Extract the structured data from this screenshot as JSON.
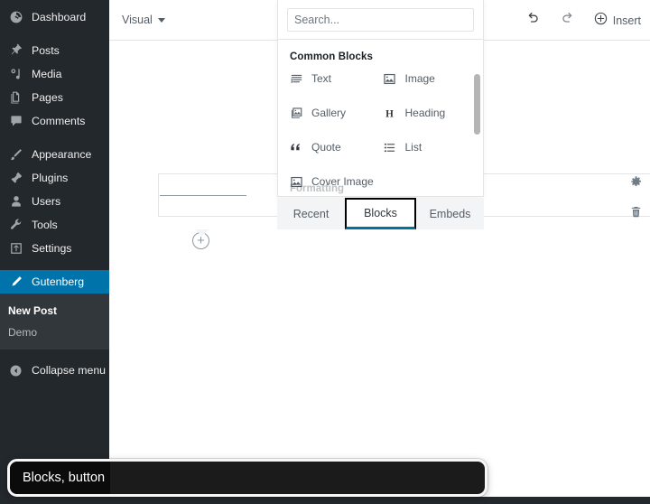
{
  "sidebar": {
    "items": [
      {
        "label": "Dashboard",
        "icon": "dashboard-icon",
        "group": 0
      },
      {
        "label": "Posts",
        "icon": "pin-icon",
        "group": 1
      },
      {
        "label": "Media",
        "icon": "media-icon",
        "group": 1
      },
      {
        "label": "Pages",
        "icon": "pages-icon",
        "group": 1
      },
      {
        "label": "Comments",
        "icon": "comment-icon",
        "group": 1
      },
      {
        "label": "Appearance",
        "icon": "brush-icon",
        "group": 2
      },
      {
        "label": "Plugins",
        "icon": "plugin-icon",
        "group": 2
      },
      {
        "label": "Users",
        "icon": "user-icon",
        "group": 2
      },
      {
        "label": "Tools",
        "icon": "wrench-icon",
        "group": 2
      },
      {
        "label": "Settings",
        "icon": "settings-icon",
        "group": 2
      },
      {
        "label": "Gutenberg",
        "icon": "pencil-icon",
        "group": 3,
        "current": true
      }
    ],
    "submenu": [
      {
        "label": "New Post",
        "current": true
      },
      {
        "label": "Demo",
        "current": false
      }
    ],
    "collapse": {
      "label": "Collapse menu",
      "icon": "collapse-arrow-icon"
    },
    "colors": {
      "background": "#23282d",
      "submenu_background": "#32373c",
      "active": "#0073aa"
    }
  },
  "toolbar": {
    "mode_label": "Visual",
    "undo_label": "Undo",
    "redo_label": "Redo",
    "insert_label": "Insert"
  },
  "block_tools": {
    "settings_label": "Settings",
    "delete_label": "Delete",
    "add_block_label": "Add block"
  },
  "inserter": {
    "search": {
      "value": "",
      "placeholder": "Search..."
    },
    "section_title": "Common Blocks",
    "next_section_partial": "Formatting",
    "blocks": [
      {
        "label": "Text",
        "icon": "text-icon"
      },
      {
        "label": "Image",
        "icon": "image-icon"
      },
      {
        "label": "Gallery",
        "icon": "gallery-icon"
      },
      {
        "label": "Heading",
        "icon": "heading-icon"
      },
      {
        "label": "Quote",
        "icon": "quote-icon"
      },
      {
        "label": "List",
        "icon": "list-icon"
      },
      {
        "label": "Cover Image",
        "icon": "cover-image-icon"
      }
    ],
    "tabs": [
      {
        "label": "Recent",
        "active": false
      },
      {
        "label": "Blocks",
        "active": true
      },
      {
        "label": "Embeds",
        "active": false
      }
    ],
    "focus_color": "#00739c"
  },
  "screen_reader": {
    "announcement": "Blocks, button"
  }
}
